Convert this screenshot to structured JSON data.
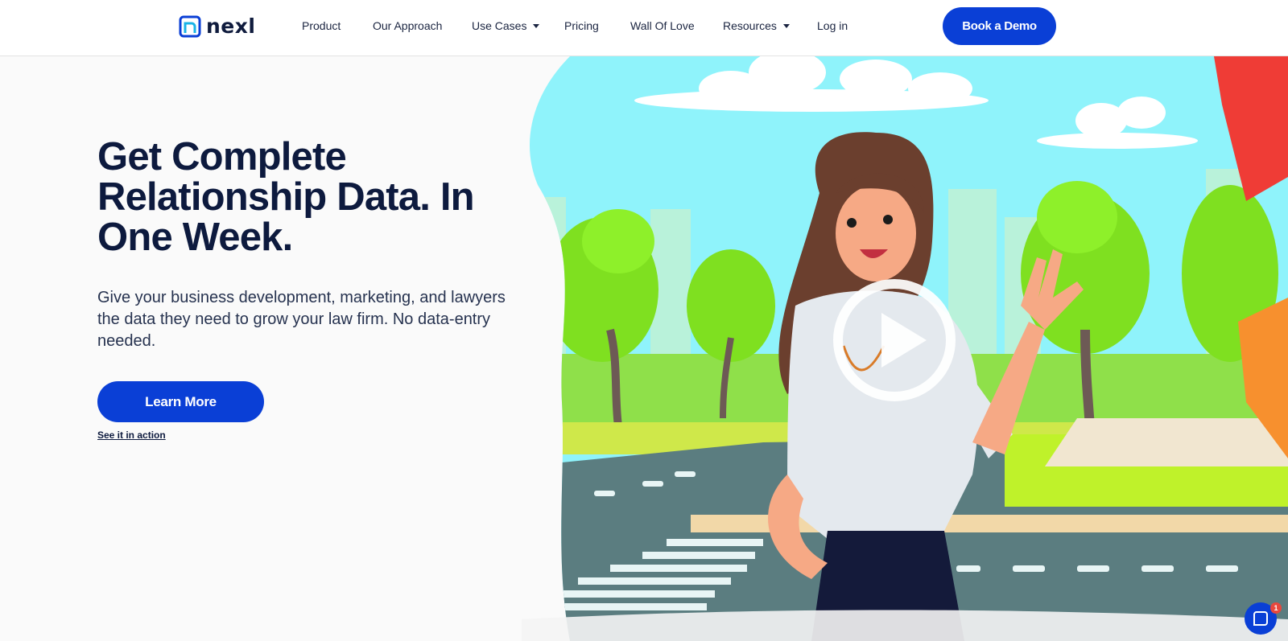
{
  "brand": {
    "name": "nexl",
    "logo_icon": "nexl-logo-mark",
    "accent": "#0a3fd6"
  },
  "nav": {
    "items": [
      {
        "label": "Product"
      },
      {
        "label": "Our Approach"
      },
      {
        "label": "Use Cases",
        "dropdown": true
      },
      {
        "label": "Pricing"
      },
      {
        "label": "Wall Of Love"
      },
      {
        "label": "Resources",
        "dropdown": true
      },
      {
        "label": "Log in"
      }
    ],
    "cta_label": "Book a Demo"
  },
  "hero": {
    "title": "Get Complete Relationship Data. In One Week.",
    "subtitle": "Give your business development, marketing, and lawyers the data they need to grow your law firm. No data-entry needed.",
    "primary_button": "Learn More",
    "secondary_link": "See it in action"
  },
  "video": {
    "play_icon": "play-icon"
  },
  "chat": {
    "icon": "chat-bubble-icon",
    "badge_count": "1"
  }
}
